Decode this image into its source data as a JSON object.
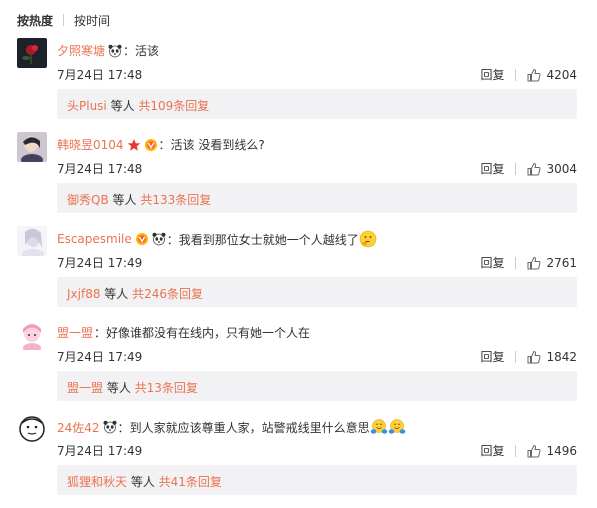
{
  "sort": {
    "hot": "按热度",
    "time": "按时间"
  },
  "comments": [
    {
      "user": "夕照寒塘",
      "text": "活该",
      "time": "7月24日 17:48",
      "reply": "回复",
      "likes": "4204",
      "sub": {
        "name": "头Plusi",
        "mid": " 等人 ",
        "count": "共109条回复"
      }
    },
    {
      "user": "韩晓昱0104",
      "text": "活该 没看到线么?",
      "time": "7月24日 17:48",
      "reply": "回复",
      "likes": "3004",
      "sub": {
        "name": "御秀QB",
        "mid": " 等人 ",
        "count": "共133条回复"
      }
    },
    {
      "user": "Escapesmile",
      "text": "我看到那位女士就她一个人越线了",
      "time": "7月24日 17:49",
      "reply": "回复",
      "likes": "2761",
      "sub": {
        "name": "Jxjf88",
        "mid": " 等人 ",
        "count": "共246条回复"
      }
    },
    {
      "user": "盟一盟",
      "text": "好像谁都没有在线内，只有她一个人在",
      "time": "7月24日 17:49",
      "reply": "回复",
      "likes": "1842",
      "sub": {
        "name": "盟一盟",
        "mid": " 等人 ",
        "count": "共13条回复"
      }
    },
    {
      "user": "24佐42",
      "text": "到人家就应该尊重人家，站警戒线里什么意思",
      "time": "7月24日 17:49",
      "reply": "回复",
      "likes": "1496",
      "sub": {
        "name": "狐狸和秋天",
        "mid": " 等人 ",
        "count": "共41条回复"
      }
    }
  ],
  "colors": {
    "link": "#eb7350",
    "sub_bg": "#f2f2f5",
    "text": "#333333"
  },
  "icons": [
    "panda-emoji-icon",
    "star-badge-icon",
    "vip-badge-icon",
    "thinking-emoji-icon",
    "hug-emoji-icon",
    "thumb-up-icon"
  ]
}
